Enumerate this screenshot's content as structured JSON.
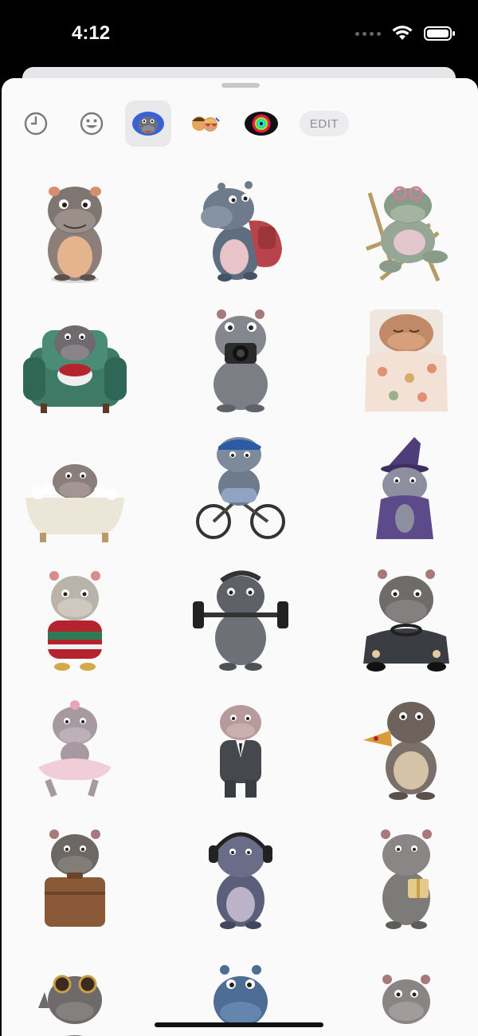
{
  "status": {
    "time": "4:12"
  },
  "toolbar": {
    "edit_label": "EDIT"
  },
  "stickers": [
    "hippo-standing",
    "hippo-backpack",
    "hippo-beach-chair",
    "hippo-armchair-popcorn",
    "hippo-camera",
    "hippo-in-bed",
    "hippo-bathtub",
    "hippo-bicycle",
    "hippo-wizard",
    "hippo-sweater",
    "hippo-dumbbell",
    "hippo-car",
    "hippo-tutu",
    "hippo-suit",
    "hippo-eating",
    "hippo-suitcase",
    "hippo-headphones",
    "hippo-gift",
    "hippo-sunglasses",
    "hippo-blue",
    "hippo-waving"
  ],
  "colors": {
    "accent": "#d9343a",
    "sheet": "#fafafa"
  }
}
